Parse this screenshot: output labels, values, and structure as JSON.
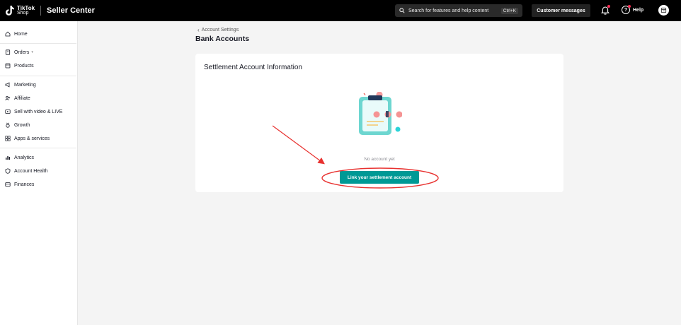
{
  "header": {
    "logo_line1": "TikTok",
    "logo_line2": "Shop",
    "app_title": "Seller Center",
    "search_placeholder": "Search for features and help content",
    "search_shortcut": "Ctrl+K",
    "customer_messages_label": "Customer messages",
    "help_label": "Help"
  },
  "sidebar": {
    "items": [
      {
        "label": "Home",
        "icon": "home-icon"
      },
      {
        "label": "Orders",
        "icon": "orders-icon"
      },
      {
        "label": "Products",
        "icon": "products-icon"
      },
      {
        "label": "Marketing",
        "icon": "megaphone-icon"
      },
      {
        "label": "Affiliate",
        "icon": "affiliate-icon"
      },
      {
        "label": "Sell with video & LIVE",
        "icon": "video-icon"
      },
      {
        "label": "Growth",
        "icon": "medal-icon"
      },
      {
        "label": "Apps & services",
        "icon": "apps-icon"
      },
      {
        "label": "Analytics",
        "icon": "analytics-icon"
      },
      {
        "label": "Account Health",
        "icon": "shield-icon"
      },
      {
        "label": "Finances",
        "icon": "wallet-icon"
      }
    ]
  },
  "main": {
    "breadcrumb": "Account Settings",
    "page_title": "Bank Accounts",
    "card": {
      "title": "Settlement Account Information",
      "empty_text": "No account yet",
      "link_button_label": "Link your settlement account"
    }
  },
  "colors": {
    "accent": "#009995",
    "annotation": "#e8312f",
    "topbar": "#000000"
  }
}
